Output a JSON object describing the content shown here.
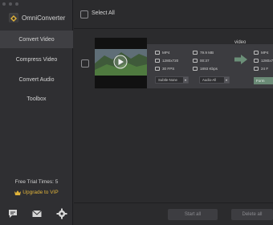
{
  "app": {
    "name": "OmniConverter"
  },
  "sidebar": {
    "items": [
      {
        "label": "Convert Video",
        "active": true
      },
      {
        "label": "Compress Video",
        "active": false
      },
      {
        "label": "Convert Audio",
        "active": false
      },
      {
        "label": "Toolbox",
        "active": false
      }
    ],
    "trial_text": "Free Trial Times: 5",
    "upgrade_text": "Upgrade to VIP",
    "bottom_icons": [
      "chat-icon",
      "mail-icon",
      "gear-icon"
    ]
  },
  "toolbar": {
    "select_all_label": "Select All"
  },
  "file": {
    "name": "video",
    "source": {
      "format": "MP4",
      "resolution": "1280x720",
      "fps": "30 FPS",
      "size": "79.9 MB",
      "duration": "00:37",
      "bitrate": "1893 Kbps"
    },
    "target": {
      "format": "MP4",
      "resolution": "1280x720",
      "fps": "24 F"
    },
    "subtitle": "Subtle-None",
    "audio": "Audio-All",
    "format_button": "Form"
  },
  "actions": {
    "start_all": "Start all",
    "delete_all": "Delete all"
  },
  "colors": {
    "accent": "#e0b33a",
    "format_button": "#6a8a76",
    "arrow": "#6b8f78"
  }
}
